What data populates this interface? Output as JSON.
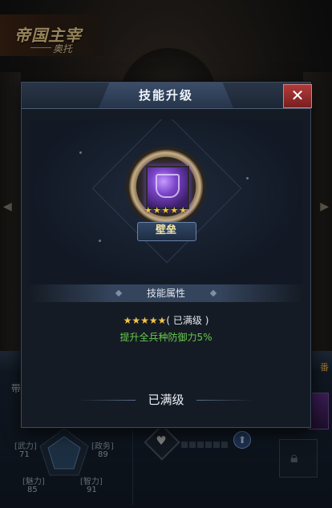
{
  "background": {
    "title": "帝国主宰",
    "subtitle": "奥托",
    "panel_tag_left": "带",
    "panel_tag_right": "番",
    "stats": [
      {
        "label": "武力",
        "value": "71"
      },
      {
        "label": "政务",
        "value": "89"
      },
      {
        "label": "魅力",
        "value": "85"
      },
      {
        "label": "智力",
        "value": "91"
      }
    ],
    "icons": [
      "heart-icon",
      "level-up-icon",
      "lock-icon"
    ]
  },
  "modal": {
    "title": "技能升级",
    "close_label": "✕",
    "skill": {
      "name": "壁垒",
      "stars": "★★★★★",
      "star_count": 5,
      "max_stars": 5
    },
    "attributes": {
      "header": "技能属性",
      "level_stars": "★★★★★",
      "level_status": "( 已满级 )",
      "effect": "提升全兵种防御力5%"
    },
    "max_level_label": "已满级"
  },
  "colors": {
    "accent_gold": "#f2c54a",
    "effect_green": "#67c94d",
    "close_red": "#b03a3a",
    "skill_purple": "#7b44c9"
  }
}
